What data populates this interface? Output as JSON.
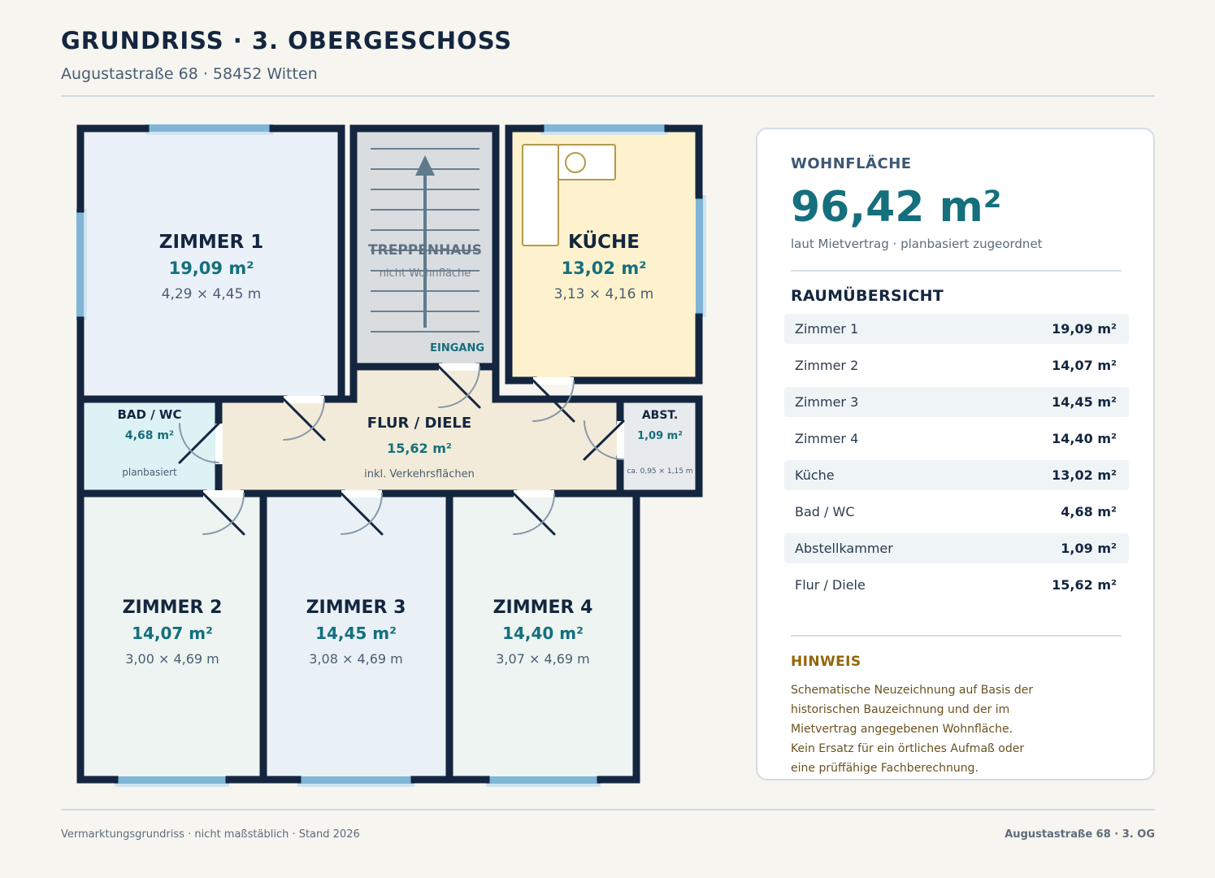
{
  "header": {
    "title": "GRUNDRISS · 3. OBERGESCHOSS",
    "subtitle": "Augustastraße 68 · 58452 Witten"
  },
  "plan": {
    "rooms": {
      "zimmer1": {
        "name": "ZIMMER 1",
        "area": "19,09 m²",
        "dims": "4,29 × 4,45 m"
      },
      "treppenhaus": {
        "name": "TREPPENHAUS",
        "note": "nicht Wohnfläche",
        "entry": "EINGANG"
      },
      "kueche": {
        "name": "KÜCHE",
        "area": "13,02 m²",
        "dims": "3,13 × 4,16 m"
      },
      "bad": {
        "name": "BAD / WC",
        "area": "4,68 m²",
        "note": "planbasiert"
      },
      "flur": {
        "name": "FLUR / DIELE",
        "area": "15,62 m²",
        "note": "inkl. Verkehrsflächen"
      },
      "abst": {
        "name": "ABST.",
        "area": "1,09 m²",
        "note": "ca. 0,95 × 1,15 m"
      },
      "zimmer2": {
        "name": "ZIMMER 2",
        "area": "14,07 m²",
        "dims": "3,00 × 4,69 m"
      },
      "zimmer3": {
        "name": "ZIMMER 3",
        "area": "14,45 m²",
        "dims": "3,08 × 4,69 m"
      },
      "zimmer4": {
        "name": "ZIMMER 4",
        "area": "14,40 m²",
        "dims": "3,07 × 4,69 m"
      }
    }
  },
  "panel": {
    "label": "WOHNFLÄCHE",
    "total": "96,42 m²",
    "note": "laut Mietvertrag · planbasiert zugeordnet",
    "overview_title": "RAUMÜBERSICHT",
    "rooms": [
      {
        "name": "Zimmer 1",
        "area": "19,09 m²"
      },
      {
        "name": "Zimmer 2",
        "area": "14,07 m²"
      },
      {
        "name": "Zimmer 3",
        "area": "14,45 m²"
      },
      {
        "name": "Zimmer 4",
        "area": "14,40 m²"
      },
      {
        "name": "Küche",
        "area": "13,02 m²"
      },
      {
        "name": "Bad / WC",
        "area": "4,68 m²"
      },
      {
        "name": "Abstellkammer",
        "area": "1,09 m²"
      },
      {
        "name": "Flur / Diele",
        "area": "15,62 m²"
      }
    ],
    "hint_title": "HINWEIS",
    "hint_lines": [
      "Schematische Neuzeichnung auf Basis der",
      "historischen Bauzeichnung und der im",
      "Mietvertrag angegebenen Wohnfläche.",
      "Kein Ersatz für ein örtliches Aufmaß oder",
      "eine prüffähige Fachberechnung."
    ]
  },
  "footer": {
    "left": "Vermarktungsgrundriss · nicht maßstäblich · Stand 2026",
    "right": "Augustastraße 68 · 3. OG"
  },
  "colors": {
    "wall": "#14263f",
    "accent": "#156f7d",
    "window": "#7fb5d6",
    "zimmer1": "#ebf1f9",
    "stairs": "#d9dde0",
    "kitchen": "#fdf2cd",
    "bath": "#ddf2f5",
    "hall": "#f3ebd9",
    "storage": "#e8ebee",
    "zimmer2": "#edf4f1",
    "zimmer3": "#e9f1f7",
    "zimmer4": "#edf4f1"
  }
}
